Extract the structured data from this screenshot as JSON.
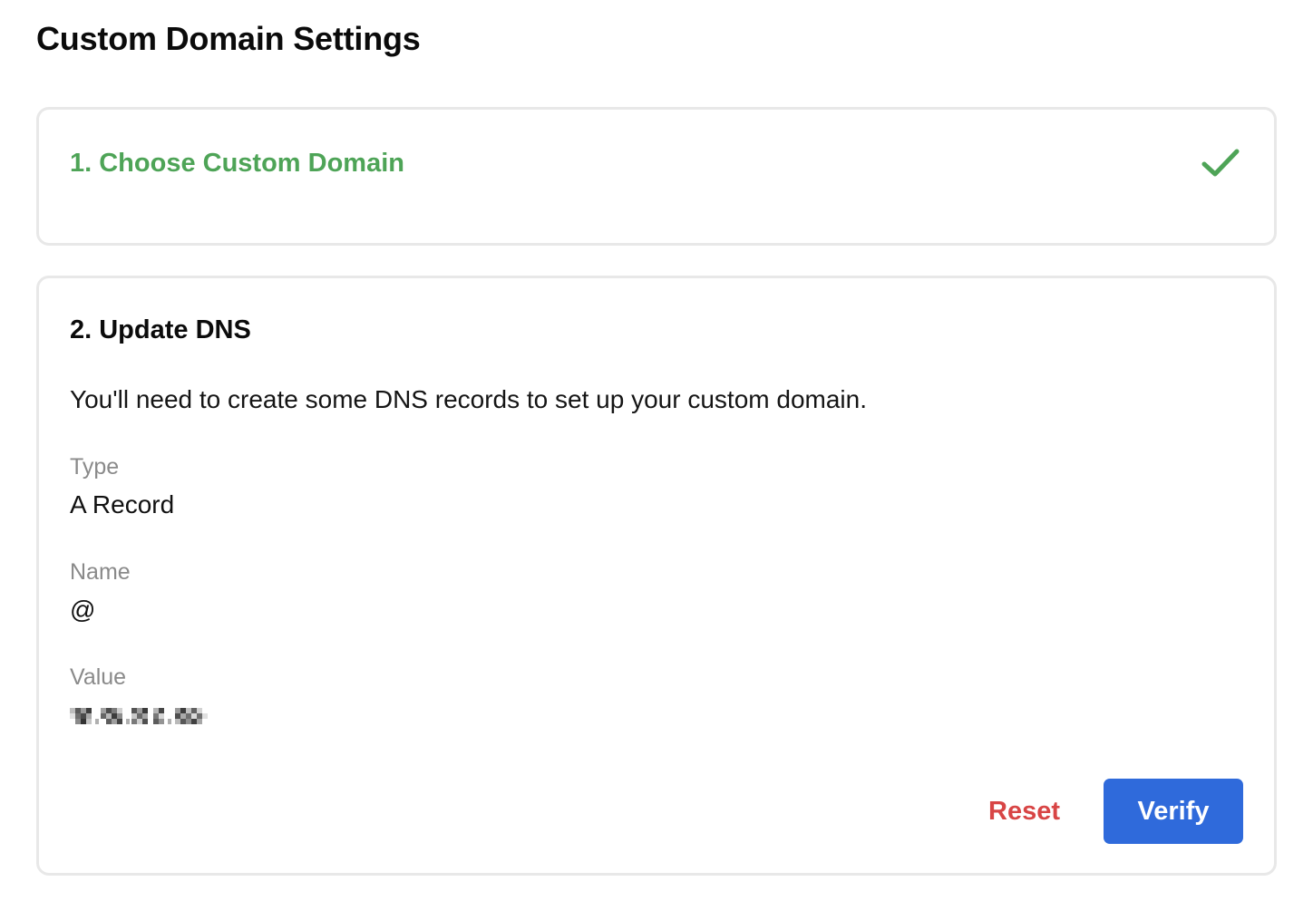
{
  "page": {
    "title": "Custom Domain Settings"
  },
  "step1": {
    "title": "1. Choose Custom Domain",
    "status_icon": "check-icon",
    "completed": true,
    "accent_color": "#4ea457"
  },
  "step2": {
    "title": "2. Update DNS",
    "description": "You'll need to create some DNS records to set up your custom domain.",
    "fields": {
      "type": {
        "label": "Type",
        "value": "A Record"
      },
      "name": {
        "label": "Name",
        "value": "@"
      },
      "value": {
        "label": "Value",
        "value_redacted": true
      }
    },
    "actions": {
      "reset_label": "Reset",
      "verify_label": "Verify"
    }
  },
  "colors": {
    "success": "#4ea457",
    "danger": "#d84545",
    "primary": "#2f6adb",
    "muted_label": "#8a8a8a",
    "card_border": "#e8e8e8"
  }
}
